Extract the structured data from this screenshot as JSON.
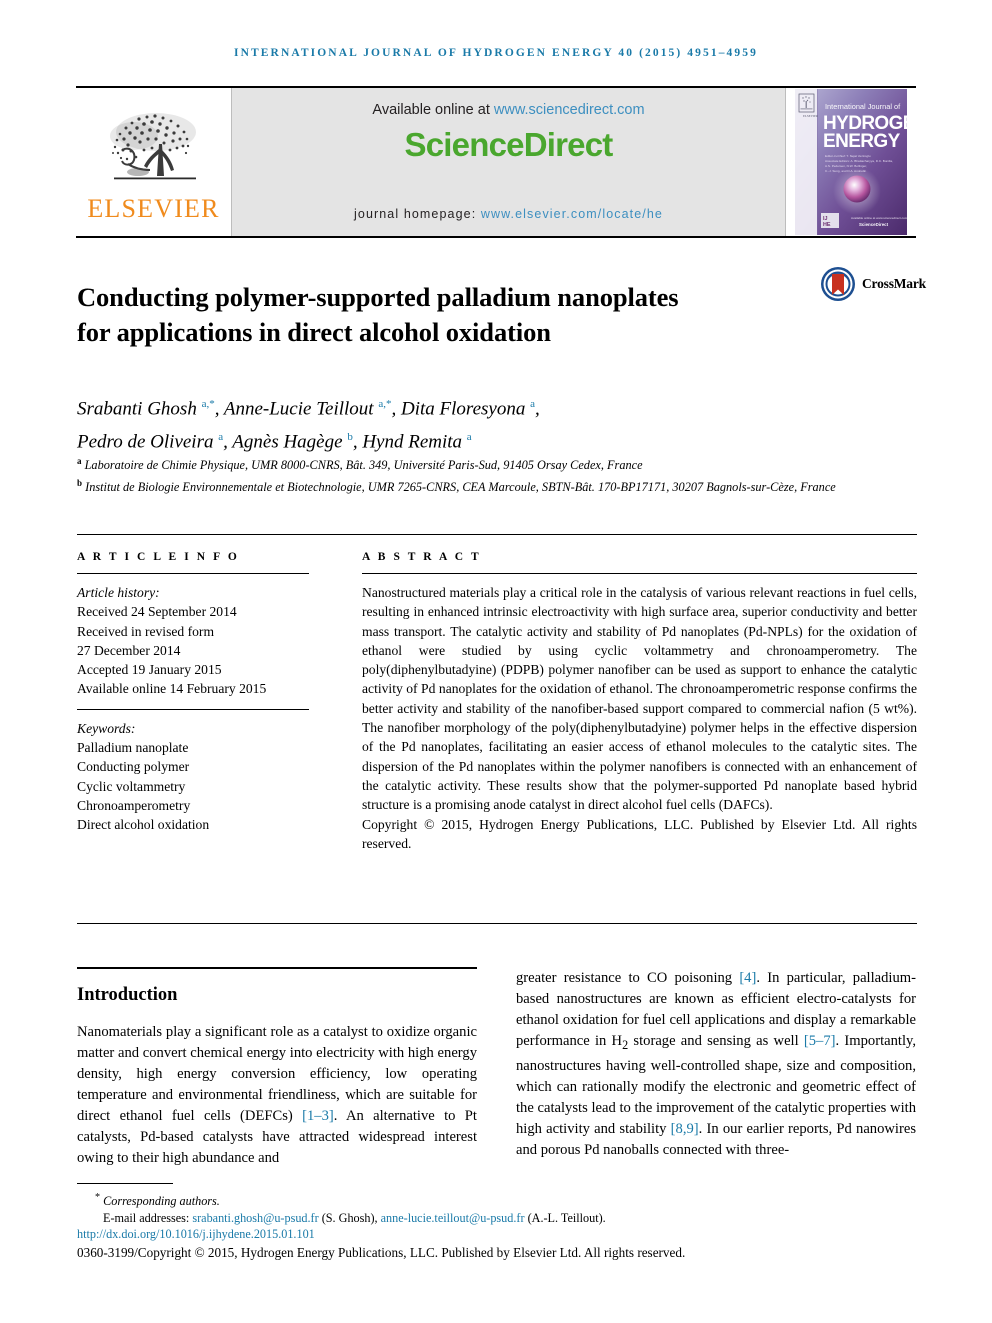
{
  "running_head": "INTERNATIONAL JOURNAL OF HYDROGEN ENERGY 40 (2015) 4951–4959",
  "masthead": {
    "publisher_name": "ELSEVIER",
    "available_prefix": "Available online at ",
    "available_url": "www.sciencedirect.com",
    "sciencedirect_part1": "Science",
    "sciencedirect_part2": "Direct",
    "homepage_label": "journal homepage: ",
    "homepage_url": "www.elsevier.com/locate/he",
    "cover": {
      "line1": "International Journal of",
      "line2": "HYDROGEN",
      "line3": "ENERGY",
      "footer_mark": "IJHE",
      "sd_mark": "ScienceDirect"
    }
  },
  "crossmark": {
    "label": "CrossMark"
  },
  "article": {
    "title": "Conducting polymer-supported palladium nanoplates for applications in direct alcohol oxidation",
    "authors_line1": "Srabanti Ghosh a,*, Anne-Lucie Teillout a,*, Dita Floresyona a,",
    "authors_line2": "Pedro de Oliveira a, Agnès Hagège b, Hynd Remita a",
    "affiliation_a": "Laboratoire de Chimie Physique, UMR 8000-CNRS, Bât. 349, Université Paris-Sud, 91405 Orsay Cedex, France",
    "affiliation_b": "Institut de Biologie Environnementale et Biotechnologie, UMR 7265-CNRS, CEA Marcoule, SBTN-Bât. 170-BP17171, 30207 Bagnols-sur-Cèze, France"
  },
  "article_info": {
    "heading": "A R T I C L E   I N F O",
    "history_label": "Article history:",
    "history": [
      "Received 24 September 2014",
      "Received in revised form",
      "27 December 2014",
      "Accepted 19 January 2015",
      "Available online 14 February 2015"
    ],
    "keywords_label": "Keywords:",
    "keywords": [
      "Palladium nanoplate",
      "Conducting polymer",
      "Cyclic voltammetry",
      "Chronoamperometry",
      "Direct alcohol oxidation"
    ]
  },
  "abstract": {
    "heading": "A B S T R A C T",
    "text": "Nanostructured materials play a critical role in the catalysis of various relevant reactions in fuel cells, resulting in enhanced intrinsic electroactivity with high surface area, superior conductivity and better mass transport. The catalytic activity and stability of Pd nanoplates (Pd-NPLs) for the oxidation of ethanol were studied by using cyclic voltammetry and chronoamperometry. The poly(diphenylbutadyine) (PDPB) polymer nanofiber can be used as support to enhance the catalytic activity of Pd nanoplates for the oxidation of ethanol. The chronoamperometric response confirms the better activity and stability of the nanofiber-based support compared to commercial nafion (5 wt%). The nanofiber morphology of the poly(diphenylbutadyine) polymer helps in the effective dispersion of the Pd nanoplates, facilitating an easier access of ethanol molecules to the catalytic sites. The dispersion of the Pd nanoplates within the polymer nanofibers is connected with an enhancement of the catalytic activity. These results show that the polymer-supported Pd nanoplate based hybrid structure is a promising anode catalyst in direct alcohol fuel cells (DAFCs).",
    "copyright": "Copyright © 2015, Hydrogen Energy Publications, LLC. Published by Elsevier Ltd. All rights reserved."
  },
  "body": {
    "intro_heading": "Introduction",
    "left_paragraph_pre": "Nanomaterials play a significant role as a catalyst to oxidize organic matter and convert chemical energy into electricity with high energy density, high energy conversion efficiency, low operating temperature and environmental friendliness, which are suitable for direct ethanol fuel cells (DEFCs) ",
    "left_ref_1": "[1–3]",
    "left_paragraph_post": ". An alternative to Pt catalysts, Pd-based catalysts have attracted widespread interest owing to their high abundance and",
    "right_seg_1": "greater resistance to CO poisoning ",
    "right_ref_1": "[4]",
    "right_seg_2": ". In particular, palladium-based nanostructures are known as efficient electro-catalysts for ethanol oxidation for fuel cell applications and display a remarkable performance in H",
    "right_sub_2": "2",
    "right_seg_3": " storage and sensing as well ",
    "right_ref_2": "[5–7]",
    "right_seg_4": ". Importantly, nanostructures having well-controlled shape, size and composition, which can rationally modify the electronic and geometric effect of the catalysts lead to the improvement of the catalytic properties with high activity and stability ",
    "right_ref_3": "[8,9]",
    "right_seg_5": ". In our earlier reports, Pd nanowires and porous Pd nanoballs connected with three-"
  },
  "footer": {
    "corresponding": "Corresponding authors.",
    "email_label": "E-mail addresses: ",
    "email1": "srabanti.ghosh@u-psud.fr",
    "email1_owner": " (S. Ghosh), ",
    "email2": "anne-lucie.teillout@u-psud.fr",
    "email2_owner": " (A.-L. Teillout).",
    "doi": "http://dx.doi.org/10.1016/j.ijhydene.2015.01.101",
    "issn_line": "0360-3199/Copyright © 2015, Hydrogen Energy Publications, LLC. Published by Elsevier Ltd. All rights reserved."
  },
  "colors": {
    "link": "#1a7aa8",
    "elsevier_orange": "#F08B1D",
    "sciencedirect_green": "#4aa72e",
    "masthead_bg": "#e4e4e4"
  }
}
